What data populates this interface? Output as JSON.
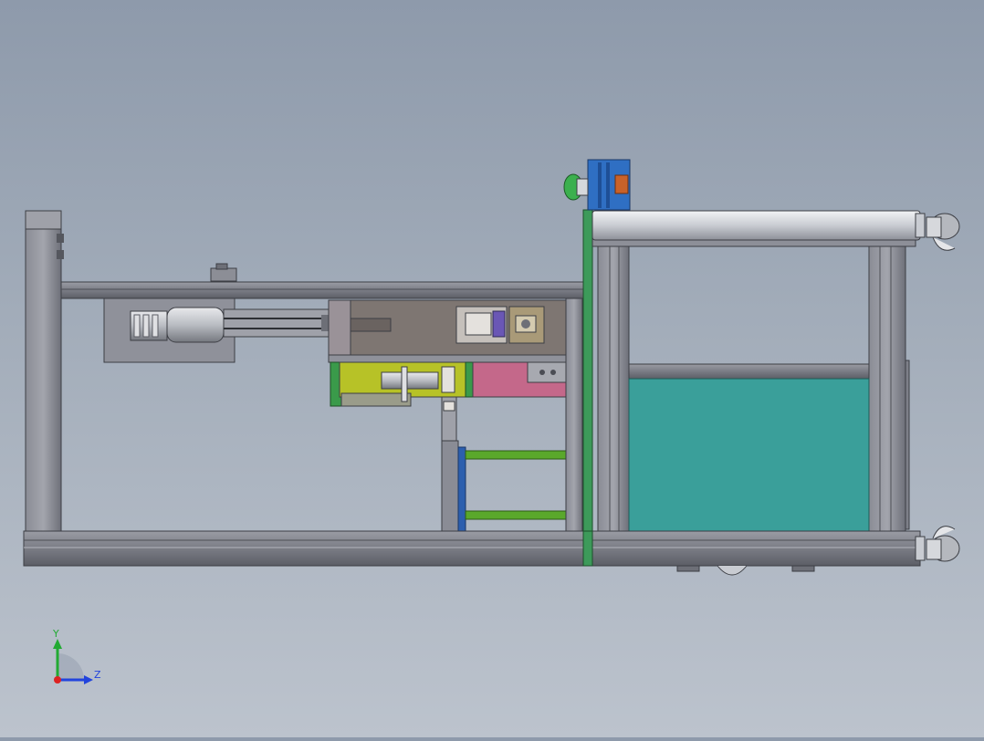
{
  "viewport": {
    "background_top": "#8e9aab",
    "background_bottom": "#bcc3cd"
  },
  "triad": {
    "y_label": "Y",
    "z_label": "Z",
    "y_color": "#22aa33",
    "z_color": "#2244dd",
    "x_color": "#dd2222"
  },
  "colors": {
    "frame_gray": "#7d7f88",
    "frame_light": "#a9abb2",
    "green_panel": "#3d9a5a",
    "teal_panel": "#3a9f9a",
    "yellow_block": "#b7c227",
    "pink_block": "#c4688a",
    "blue_block": "#2f6fc3",
    "orange_block": "#c8622a",
    "purple_part": "#6a57b5",
    "green_bar": "#5aa82b",
    "blue_column": "#2c5fae"
  }
}
